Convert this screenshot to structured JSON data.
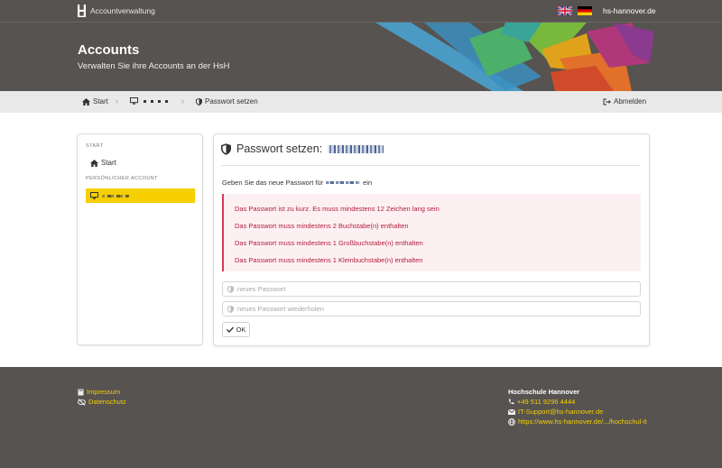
{
  "topbar": {
    "app_title": "Accountverwaltung",
    "site_link": "hs-hannover.de",
    "languages": [
      "en",
      "de"
    ]
  },
  "header": {
    "title": "Accounts",
    "subtitle": "Verwalten Sie ihre Accounts an der HsH"
  },
  "breadcrumb": {
    "items": [
      {
        "label": "Start",
        "icon": "home-icon"
      },
      {
        "label": "",
        "icon": "monitor-icon"
      },
      {
        "label": "Passwort setzen",
        "icon": "shield-icon"
      }
    ],
    "logout_label": "Abmelden"
  },
  "sidebar": {
    "section_start": "START",
    "start_label": "Start",
    "section_account": "PERSÖNLICHER ACCOUNT"
  },
  "main": {
    "title": "Passwort setzen:",
    "instruction_prefix": "Geben Sie das neue Passwort für",
    "instruction_suffix": "ein",
    "errors": [
      "Das Passwort ist zu kurz. Es muss mindestens 12 Zeichen lang sein",
      "Das Passwort muss mindestens 2 Buchstabe(n) enthalten",
      "Das Passwort muss mindestens 1 Großbuchstabe(n) enthalten",
      "Das Passwort muss mindestens 1 Kleinbuchstabe(n) enthalten"
    ],
    "password_placeholder": "neues Passwort",
    "repeat_placeholder": "neues Passwort wiederholen",
    "ok_label": "OK"
  },
  "footer": {
    "impressum": "Impressum",
    "datenschutz": "Datenschutz",
    "org": "Hochschule Hannover",
    "phone": "+49 511 9296 4444",
    "email": "IT-Support@hs-hannover.de",
    "url": "https://www.hs-hannover.de/.../hochschul-it"
  },
  "colors": {
    "dark_bg": "#575350",
    "accent_yellow": "#f5cf00",
    "error_red": "#b11d3c"
  }
}
